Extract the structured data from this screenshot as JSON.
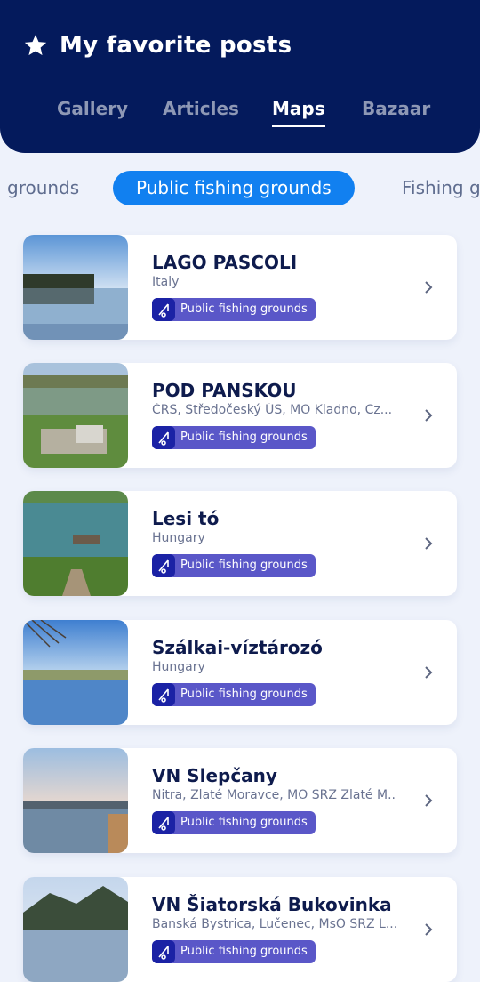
{
  "header": {
    "title": "My favorite posts",
    "star_icon": "star-icon",
    "tabs": [
      {
        "label": "Gallery",
        "active": false
      },
      {
        "label": "Articles",
        "active": false
      },
      {
        "label": "Maps",
        "active": true
      },
      {
        "label": "Bazaar",
        "active": false
      }
    ]
  },
  "filters": [
    {
      "label": "grounds",
      "active": false
    },
    {
      "label": "Public fishing grounds",
      "active": true
    },
    {
      "label": "Fishing g",
      "active": false
    }
  ],
  "colors": {
    "header_bg": "#041a5c",
    "accent": "#1180f0",
    "badge": "#5a57c8",
    "badge_icon_bg": "#1b22a5"
  },
  "posts": [
    {
      "name": "LAGO PASCOLI",
      "location": "Italy",
      "badge": "Public fishing grounds"
    },
    {
      "name": "POD PANSKOU",
      "location": "ČRS, Středočeský ÚS, MO Kladno, Cz...",
      "badge": "Public fishing grounds"
    },
    {
      "name": "Lesi tó",
      "location": "Hungary",
      "badge": "Public fishing grounds"
    },
    {
      "name": "Szálkai-víztározó",
      "location": "Hungary",
      "badge": "Public fishing grounds"
    },
    {
      "name": "VN Slepčany",
      "location": "Nitra, Zlaté Moravce, MO SRZ Zlaté M...",
      "badge": "Public fishing grounds"
    },
    {
      "name": "VN Šiatorská Bukovinka",
      "location": "Banská Bystrica, Lučenec, MsO SRZ L...",
      "badge": "Public fishing grounds"
    }
  ]
}
